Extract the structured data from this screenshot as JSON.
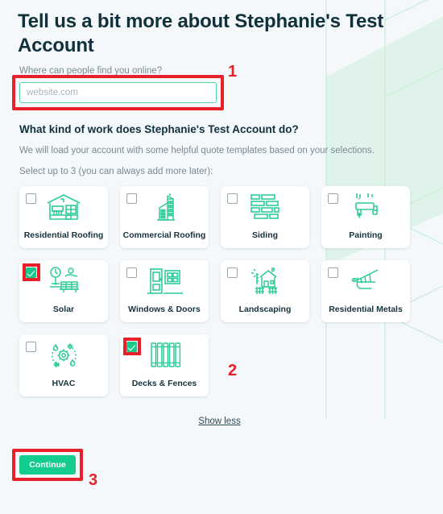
{
  "header": {
    "title": "Tell us a bit more about Stephanie's Test Account",
    "website_label": "Where can people find you online?"
  },
  "website_field": {
    "value": "",
    "placeholder": "website.com"
  },
  "work_section": {
    "heading": "What kind of work does Stephanie's Test Account do?",
    "note": "We will load your account with some helpful quote templates based on your selections.",
    "select_note": "Select up to 3 (you can always add more later):"
  },
  "trades": [
    {
      "label": "Residential Roofing",
      "icon": "house-icon",
      "checked": false,
      "annotated": false
    },
    {
      "label": "Commercial Roofing",
      "icon": "office-building-icon",
      "checked": false,
      "annotated": false
    },
    {
      "label": "Siding",
      "icon": "brick-wall-icon",
      "checked": false,
      "annotated": false
    },
    {
      "label": "Painting",
      "icon": "paint-roller-icon",
      "checked": false,
      "annotated": false
    },
    {
      "label": "Solar",
      "icon": "solar-panel-icon",
      "checked": true,
      "annotated": true
    },
    {
      "label": "Windows & Doors",
      "icon": "window-door-icon",
      "checked": false,
      "annotated": false
    },
    {
      "label": "Landscaping",
      "icon": "house-garden-icon",
      "checked": false,
      "annotated": false
    },
    {
      "label": "Residential Metals",
      "icon": "metal-roof-icon",
      "checked": false,
      "annotated": false
    },
    {
      "label": "HVAC",
      "icon": "hvac-gear-icon",
      "checked": false,
      "annotated": false
    },
    {
      "label": "Decks & Fences",
      "icon": "fence-icon",
      "checked": true,
      "annotated": true
    }
  ],
  "show_less": {
    "label": "Show less"
  },
  "footer": {
    "continue_label": "Continue"
  },
  "annotations": [
    {
      "number": "1",
      "target": "website-input"
    },
    {
      "number": "2",
      "target": "decks-and-fences-card"
    },
    {
      "number": "3",
      "target": "continue-button"
    }
  ],
  "colors": {
    "accent_green": "#14cc8e",
    "icon_green": "#2ecb9a",
    "annotation_red": "#e8202a",
    "page_background": "#f4f8fa",
    "heading_text": "#10313c",
    "muted_text": "#7b8b93"
  }
}
